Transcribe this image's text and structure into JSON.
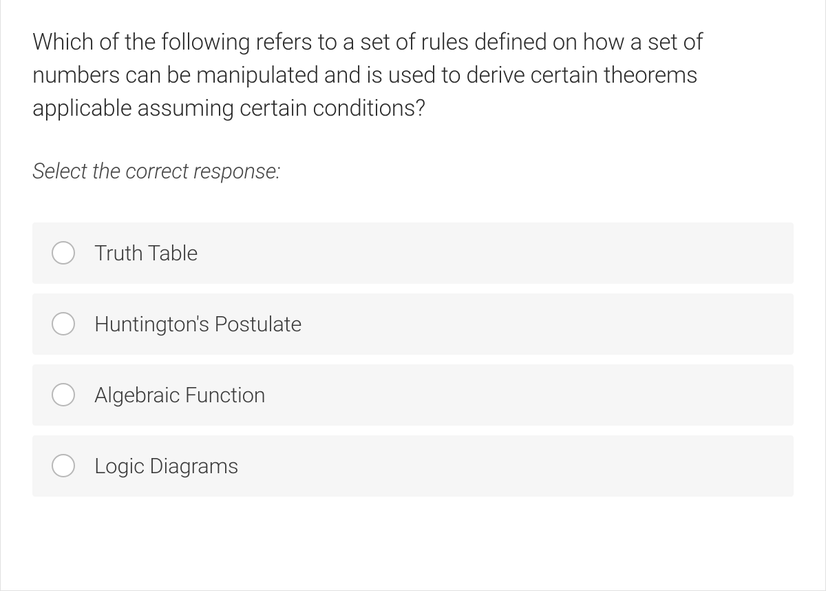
{
  "question": {
    "text": "Which of the following refers to a set of rules defined on how a set of numbers can be manipulated and is used to derive certain theorems applicable assuming certain conditions?",
    "instruction": "Select the correct response:",
    "options": [
      {
        "label": "Truth Table"
      },
      {
        "label": "Huntington's Postulate"
      },
      {
        "label": "Algebraic Function"
      },
      {
        "label": "Logic Diagrams"
      }
    ]
  }
}
